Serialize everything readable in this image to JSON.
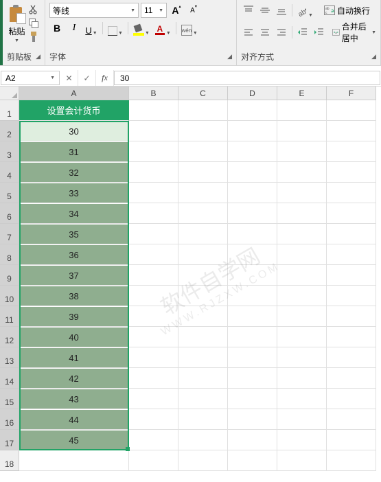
{
  "ribbon": {
    "clipboard": {
      "paste_label": "粘贴",
      "group_label": "剪贴板"
    },
    "font": {
      "name": "等线",
      "size": "11",
      "bold": "B",
      "italic": "I",
      "underline": "U",
      "wen": "wén",
      "color_letter": "A",
      "group_label": "字体"
    },
    "align": {
      "wrap_label": "自动换行",
      "merge_label": "合并后居中",
      "group_label": "对齐方式"
    }
  },
  "formula_bar": {
    "name_box": "A2",
    "cancel": "✕",
    "confirm": "✓",
    "fx": "fx",
    "value": "30"
  },
  "columns": [
    "A",
    "B",
    "C",
    "D",
    "E",
    "F"
  ],
  "header_cell": "设置会计货币",
  "chart_data": {
    "type": "table",
    "title": "设置会计货币",
    "columns": [
      "A"
    ],
    "rows": [
      {
        "row": 2,
        "A": "30"
      },
      {
        "row": 3,
        "A": "31"
      },
      {
        "row": 4,
        "A": "32"
      },
      {
        "row": 5,
        "A": "33"
      },
      {
        "row": 6,
        "A": "34"
      },
      {
        "row": 7,
        "A": "35"
      },
      {
        "row": 8,
        "A": "36"
      },
      {
        "row": 9,
        "A": "37"
      },
      {
        "row": 10,
        "A": "38"
      },
      {
        "row": 11,
        "A": "39"
      },
      {
        "row": 12,
        "A": "40"
      },
      {
        "row": 13,
        "A": "41"
      },
      {
        "row": 14,
        "A": "42"
      },
      {
        "row": 15,
        "A": "43"
      },
      {
        "row": 16,
        "A": "44"
      },
      {
        "row": 17,
        "A": "45"
      }
    ]
  },
  "row_labels": [
    "1",
    "2",
    "3",
    "4",
    "5",
    "6",
    "7",
    "8",
    "9",
    "10",
    "11",
    "12",
    "13",
    "14",
    "15",
    "16",
    "17",
    "18"
  ],
  "watermark": {
    "line1": "软件自学网",
    "line2": "WWW.RJZXW.COM"
  }
}
